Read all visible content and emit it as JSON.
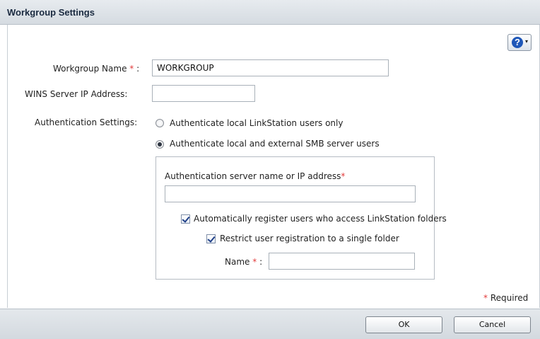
{
  "dialog": {
    "title": "Workgroup Settings",
    "help_glyph": "?",
    "help_caret": "▾"
  },
  "form": {
    "workgroup_name": {
      "label": "Workgroup Name",
      "required_mark": "*",
      "colon": ":",
      "value": "WORKGROUP"
    },
    "wins_server": {
      "label": "WINS Server IP Address:",
      "value": ""
    },
    "auth_settings": {
      "label": "Authentication Settings:",
      "options": [
        {
          "label": "Authenticate local LinkStation users only",
          "selected": false
        },
        {
          "label": "Authenticate local and external SMB server users",
          "selected": true
        }
      ]
    },
    "auth_server": {
      "label": "Authentication server name or IP address",
      "required_mark": "*",
      "value": ""
    },
    "auto_register": {
      "label": "Automatically register users who access LinkStation folders",
      "checked": true
    },
    "restrict_folder": {
      "label": "Restrict user registration to a single folder",
      "checked": true
    },
    "folder_name": {
      "label": "Name",
      "required_mark": "*",
      "colon": ":",
      "value": ""
    }
  },
  "required_note": {
    "mark": "*",
    "text": "Required"
  },
  "buttons": {
    "ok": "OK",
    "cancel": "Cancel"
  },
  "colors": {
    "required": "#e23b3b",
    "help_blue": "#1f57b8",
    "title": "#1a2a40"
  }
}
